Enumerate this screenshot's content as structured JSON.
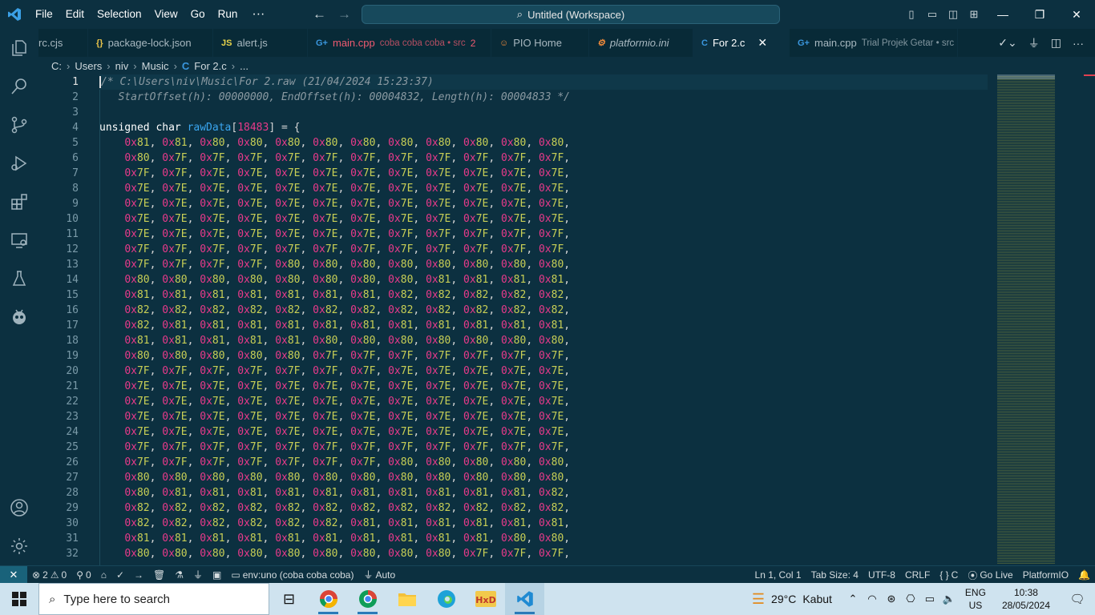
{
  "titlebar": {
    "menu": [
      "File",
      "Edit",
      "Selection",
      "View",
      "Go",
      "Run"
    ],
    "more": "···",
    "command_center": "Untitled (Workspace)",
    "minimize": "—",
    "restore": "❐",
    "close": "✕"
  },
  "tabs": [
    {
      "icon": "",
      "label": "rc.cjs",
      "desc": "",
      "badge": "",
      "icon_color": "#a8b8c0",
      "label_color": "#a8b8c0"
    },
    {
      "icon": "{}",
      "label": "package-lock.json",
      "desc": "",
      "badge": "",
      "icon_color": "#e8c34a",
      "label_color": "#a8b8c0"
    },
    {
      "icon": "JS",
      "label": "alert.js",
      "desc": "",
      "badge": "",
      "icon_color": "#e8d44a",
      "label_color": "#a8b8c0"
    },
    {
      "icon": "G+",
      "label": "main.cpp",
      "desc": "coba coba coba • src",
      "badge": "2",
      "icon_color": "#3a96dd",
      "label_color": "#ee5a70"
    },
    {
      "icon": "☺",
      "label": "PIO Home",
      "desc": "",
      "badge": "",
      "icon_color": "#f08a3a",
      "label_color": "#a8b8c0"
    },
    {
      "icon": "⚙",
      "label": "platformio.ini",
      "desc": "",
      "badge": "",
      "icon_color": "#f08a3a",
      "label_color": "#a8b8c0"
    },
    {
      "icon": "C",
      "label": "For 2.c",
      "desc": "",
      "badge": "",
      "icon_color": "#3a96dd",
      "label_color": "#ffffff"
    },
    {
      "icon": "G+",
      "label": "main.cpp",
      "desc": "Trial Projek Getar • src",
      "badge": "",
      "icon_color": "#3a96dd",
      "label_color": "#a8b8c0"
    }
  ],
  "breadcrumb": {
    "parts": [
      "C:",
      "Users",
      "niv",
      "Music"
    ],
    "file_icon": "C",
    "file": "For 2.c",
    "tail": "..."
  },
  "editor": {
    "line_numbers": [
      "1",
      "2",
      "3",
      "4",
      "5",
      "6",
      "7",
      "8",
      "9",
      "10",
      "11",
      "12",
      "13",
      "14",
      "15",
      "16",
      "17",
      "18",
      "19",
      "20",
      "21",
      "22",
      "23",
      "24",
      "25",
      "26",
      "27",
      "28",
      "29",
      "30",
      "31",
      "32"
    ],
    "comment_line1": "/* C:\\Users\\niv\\Music\\For 2.raw (21/04/2024 15:23:37)",
    "comment_line2": "   StartOffset(h): 00000000, EndOffset(h): 00004832, Length(h): 00004833 */",
    "decl_type": "unsigned char",
    "decl_name": "rawData",
    "decl_size": "18483",
    "decl_tail": "] = {",
    "data_rows": [
      [
        "81",
        "81",
        "80",
        "80",
        "80",
        "80",
        "80",
        "80",
        "80",
        "80",
        "80",
        "80"
      ],
      [
        "80",
        "7F",
        "7F",
        "7F",
        "7F",
        "7F",
        "7F",
        "7F",
        "7F",
        "7F",
        "7F",
        "7F"
      ],
      [
        "7F",
        "7F",
        "7E",
        "7E",
        "7E",
        "7E",
        "7E",
        "7E",
        "7E",
        "7E",
        "7E",
        "7E"
      ],
      [
        "7E",
        "7E",
        "7E",
        "7E",
        "7E",
        "7E",
        "7E",
        "7E",
        "7E",
        "7E",
        "7E",
        "7E"
      ],
      [
        "7E",
        "7E",
        "7E",
        "7E",
        "7E",
        "7E",
        "7E",
        "7E",
        "7E",
        "7E",
        "7E",
        "7E"
      ],
      [
        "7E",
        "7E",
        "7E",
        "7E",
        "7E",
        "7E",
        "7E",
        "7E",
        "7E",
        "7E",
        "7E",
        "7E"
      ],
      [
        "7E",
        "7E",
        "7E",
        "7E",
        "7E",
        "7E",
        "7E",
        "7F",
        "7F",
        "7F",
        "7F",
        "7F"
      ],
      [
        "7F",
        "7F",
        "7F",
        "7F",
        "7F",
        "7F",
        "7F",
        "7F",
        "7F",
        "7F",
        "7F",
        "7F"
      ],
      [
        "7F",
        "7F",
        "7F",
        "7F",
        "80",
        "80",
        "80",
        "80",
        "80",
        "80",
        "80",
        "80"
      ],
      [
        "80",
        "80",
        "80",
        "80",
        "80",
        "80",
        "80",
        "80",
        "81",
        "81",
        "81",
        "81"
      ],
      [
        "81",
        "81",
        "81",
        "81",
        "81",
        "81",
        "81",
        "82",
        "82",
        "82",
        "82",
        "82"
      ],
      [
        "82",
        "82",
        "82",
        "82",
        "82",
        "82",
        "82",
        "82",
        "82",
        "82",
        "82",
        "82"
      ],
      [
        "82",
        "81",
        "81",
        "81",
        "81",
        "81",
        "81",
        "81",
        "81",
        "81",
        "81",
        "81"
      ],
      [
        "81",
        "81",
        "81",
        "81",
        "81",
        "80",
        "80",
        "80",
        "80",
        "80",
        "80",
        "80"
      ],
      [
        "80",
        "80",
        "80",
        "80",
        "80",
        "7F",
        "7F",
        "7F",
        "7F",
        "7F",
        "7F",
        "7F"
      ],
      [
        "7F",
        "7F",
        "7F",
        "7F",
        "7F",
        "7F",
        "7F",
        "7E",
        "7E",
        "7E",
        "7E",
        "7E"
      ],
      [
        "7E",
        "7E",
        "7E",
        "7E",
        "7E",
        "7E",
        "7E",
        "7E",
        "7E",
        "7E",
        "7E",
        "7E"
      ],
      [
        "7E",
        "7E",
        "7E",
        "7E",
        "7E",
        "7E",
        "7E",
        "7E",
        "7E",
        "7E",
        "7E",
        "7E"
      ],
      [
        "7E",
        "7E",
        "7E",
        "7E",
        "7E",
        "7E",
        "7E",
        "7E",
        "7E",
        "7E",
        "7E",
        "7E"
      ],
      [
        "7E",
        "7E",
        "7E",
        "7E",
        "7E",
        "7E",
        "7E",
        "7E",
        "7E",
        "7E",
        "7E",
        "7E"
      ],
      [
        "7F",
        "7F",
        "7F",
        "7F",
        "7F",
        "7F",
        "7F",
        "7F",
        "7F",
        "7F",
        "7F",
        "7F"
      ],
      [
        "7F",
        "7F",
        "7F",
        "7F",
        "7F",
        "7F",
        "7F",
        "80",
        "80",
        "80",
        "80",
        "80"
      ],
      [
        "80",
        "80",
        "80",
        "80",
        "80",
        "80",
        "80",
        "80",
        "80",
        "80",
        "80",
        "80"
      ],
      [
        "80",
        "81",
        "81",
        "81",
        "81",
        "81",
        "81",
        "81",
        "81",
        "81",
        "81",
        "82"
      ],
      [
        "82",
        "82",
        "82",
        "82",
        "82",
        "82",
        "82",
        "82",
        "82",
        "82",
        "82",
        "82"
      ],
      [
        "82",
        "82",
        "82",
        "82",
        "82",
        "82",
        "81",
        "81",
        "81",
        "81",
        "81",
        "81"
      ],
      [
        "81",
        "81",
        "81",
        "81",
        "81",
        "81",
        "81",
        "81",
        "81",
        "81",
        "80",
        "80"
      ],
      [
        "80",
        "80",
        "80",
        "80",
        "80",
        "80",
        "80",
        "80",
        "80",
        "7F",
        "7F",
        "7F"
      ]
    ]
  },
  "statusbar": {
    "remote": "✕",
    "errors": "2",
    "warnings": "0",
    "ports": "0",
    "env": "env:uno (coba coba coba)",
    "auto": "Auto",
    "position": "Ln 1, Col 1",
    "tab_size": "Tab Size: 4",
    "encoding": "UTF-8",
    "eol": "CRLF",
    "language": "C",
    "golive": "Go Live",
    "platformio": "PlatformIO"
  },
  "taskbar": {
    "search_placeholder": "Type here to search",
    "weather_temp": "29°C",
    "weather_desc": "Kabut",
    "lang_top": "ENG",
    "lang_bottom": "US",
    "time": "10:38",
    "date": "28/05/2024"
  },
  "colors": {
    "background": "#0c3040",
    "hex_prefix": "#e83a8a",
    "hex_digits": "#c8cf56",
    "variable": "#3aa6f0",
    "comment": "#8b9aa2"
  }
}
